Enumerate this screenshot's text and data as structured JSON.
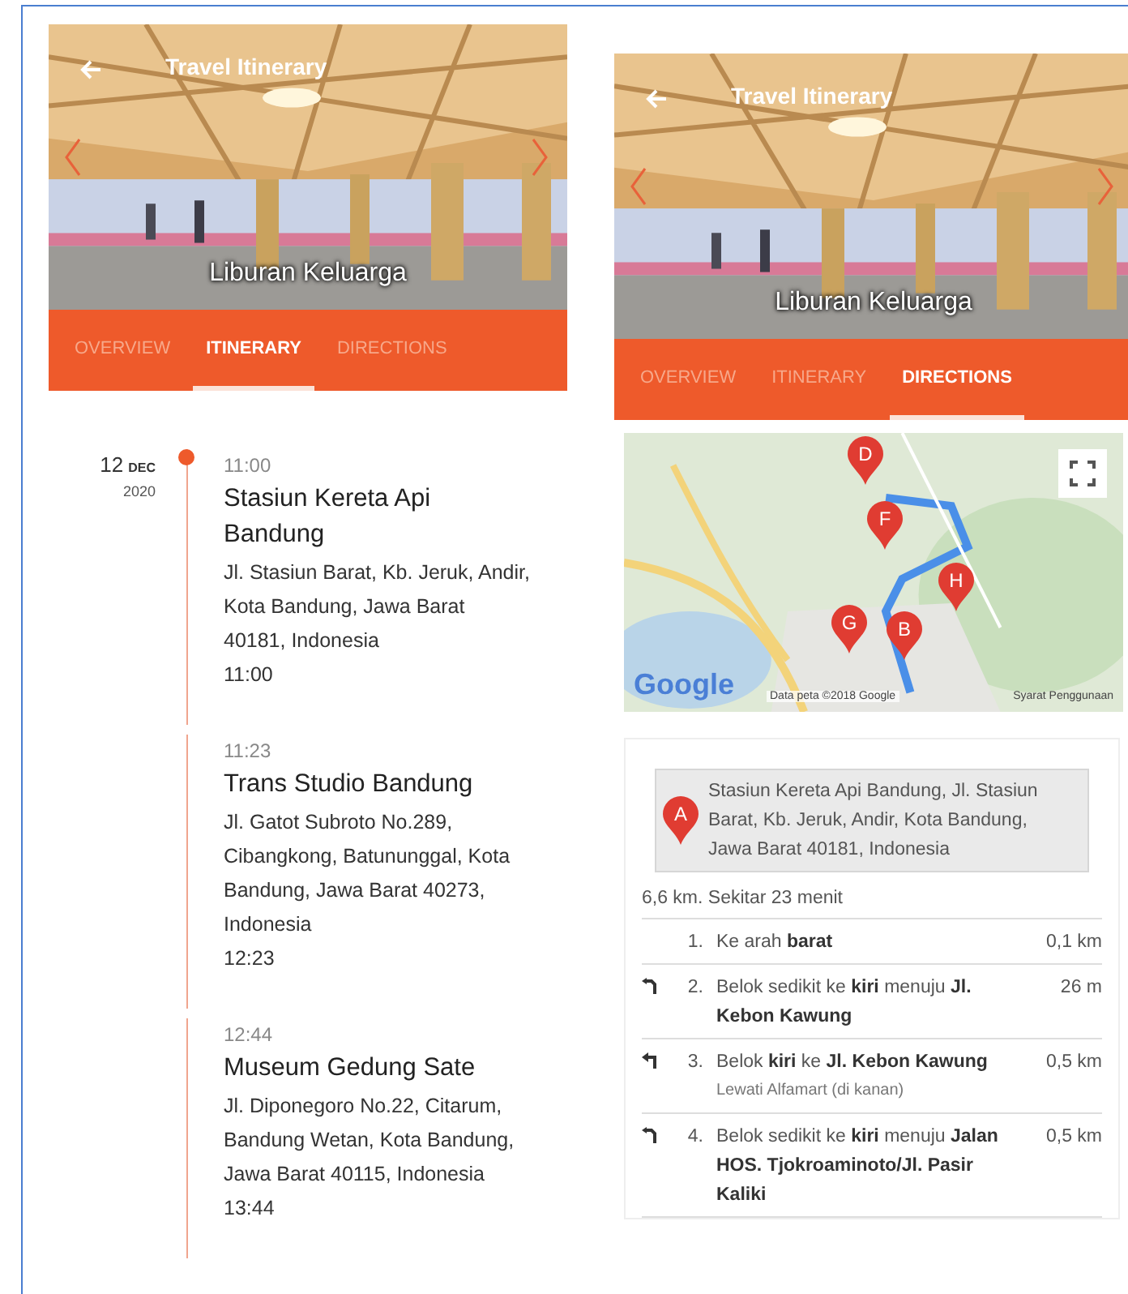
{
  "panels": [
    {
      "kind": "itinerary",
      "header": {
        "title": "Travel Itinerary",
        "caption": "Liburan Keluarga"
      },
      "tabs": [
        {
          "label": "OVERVIEW",
          "selected": false
        },
        {
          "label": "ITINERARY",
          "selected": true
        },
        {
          "label": "DIRECTIONS",
          "selected": false
        }
      ],
      "date": {
        "day": "12",
        "month": "DEC",
        "year": "2020"
      },
      "stops": [
        {
          "time": "11:00",
          "name": "Stasiun Kereta Api Bandung",
          "address": "Jl. Stasiun Barat, Kb. Jeruk, Andir, Kota Bandung, Jawa Barat 40181, Indonesia",
          "end_time": "11:00"
        },
        {
          "time": "11:23",
          "name": "Trans Studio Bandung",
          "address": "Jl. Gatot Subroto No.289, Cibangkong, Batununggal, Kota Bandung, Jawa Barat 40273, Indonesia",
          "end_time": "12:23"
        },
        {
          "time": "12:44",
          "name": "Museum Gedung Sate",
          "address": "Jl. Diponegoro No.22, Citarum, Bandung Wetan, Kota Bandung, Jawa Barat 40115, Indonesia",
          "end_time": "13:44"
        }
      ]
    },
    {
      "kind": "directions",
      "header": {
        "title": "Travel Itinerary",
        "caption": "Liburan Keluarga"
      },
      "tabs": [
        {
          "label": "OVERVIEW",
          "selected": false
        },
        {
          "label": "ITINERARY",
          "selected": false
        },
        {
          "label": "DIRECTIONS",
          "selected": true
        }
      ],
      "map": {
        "markers": [
          {
            "label": "D"
          },
          {
            "label": "F"
          },
          {
            "label": "H"
          },
          {
            "label": "G"
          },
          {
            "label": "B"
          }
        ],
        "logo": "Google",
        "attribution": "Data peta ©2018 Google",
        "terms": "Syarat Penggunaan"
      },
      "start": {
        "marker": "A",
        "address": "Stasiun Kereta Api Bandung, Jl. Stasiun Barat, Kb. Jeruk, Andir, Kota Bandung, Jawa Barat 40181, Indonesia"
      },
      "summary": "6,6 km. Sekitar 23 menit",
      "steps": [
        {
          "kind": "straight",
          "num": "1.",
          "text": "Ke arah **barat**",
          "distance": "0,1 km"
        },
        {
          "kind": "slight-left",
          "num": "2.",
          "text": "Belok sedikit ke **kiri** menuju **Jl. Kebon Kawung**",
          "distance": "26 m"
        },
        {
          "kind": "left",
          "num": "3.",
          "text": "Belok **kiri** ke **Jl. Kebon Kawung**",
          "note": "Lewati Alfamart (di kanan)",
          "distance": "0,5 km"
        },
        {
          "kind": "slight-left",
          "num": "4.",
          "text": "Belok sedikit ke **kiri** menuju **Jalan HOS. Tjokroaminoto/Jl. Pasir Kaliki**",
          "distance": "0,5 km"
        }
      ]
    }
  ]
}
